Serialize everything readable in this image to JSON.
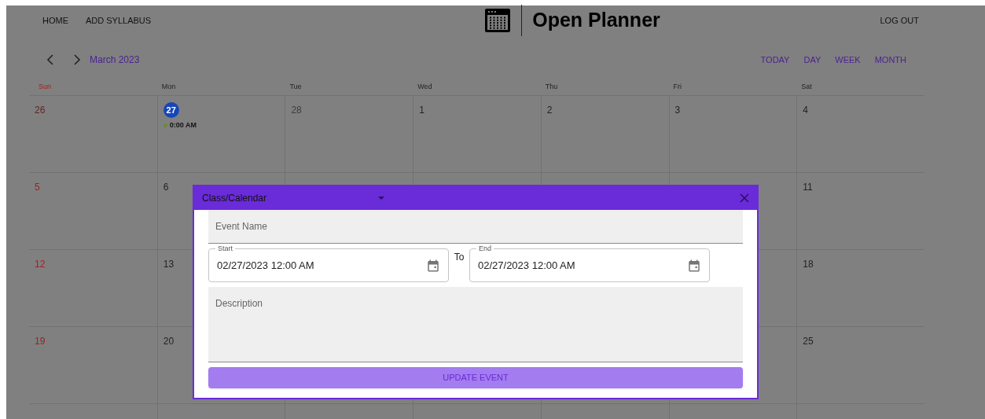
{
  "nav": [
    {
      "label": "HOME"
    },
    {
      "label": "ADD SYLLABUS"
    }
  ],
  "app_title": "Open Planner",
  "logout": "LOG OUT",
  "calendar": {
    "title": "March 2023",
    "buttons": [
      "TODAY",
      "DAY",
      "WEEK",
      "MONTH"
    ],
    "weekdays": [
      {
        "label": "Sun",
        "kind": "sunday"
      },
      {
        "label": "Mon",
        "kind": "weekday"
      },
      {
        "label": "Tue",
        "kind": "weekday"
      },
      {
        "label": "Wed",
        "kind": "weekday"
      },
      {
        "label": "Thu",
        "kind": "weekday"
      },
      {
        "label": "Fri",
        "kind": "weekday"
      },
      {
        "label": "Sat",
        "kind": "weekday"
      }
    ],
    "weeks": [
      [
        {
          "day": "26",
          "kind": "other-month"
        },
        {
          "day": "27",
          "kind": "today",
          "events": [
            {
              "time": "0:00 AM",
              "color": "#6b8a3a"
            }
          ]
        },
        {
          "day": "28",
          "kind": "other-month"
        },
        {
          "day": "1",
          "kind": "current"
        },
        {
          "day": "2",
          "kind": "current"
        },
        {
          "day": "3",
          "kind": "current"
        },
        {
          "day": "4",
          "kind": "current"
        }
      ],
      [
        {
          "day": "5",
          "kind": "current"
        },
        {
          "day": "6",
          "kind": "current"
        },
        {
          "kind": "hidden"
        },
        {
          "kind": "hidden"
        },
        {
          "kind": "hidden"
        },
        {
          "kind": "hidden"
        },
        {
          "day": "11",
          "kind": "current"
        }
      ],
      [
        {
          "day": "12",
          "kind": "current"
        },
        {
          "day": "13",
          "kind": "current"
        },
        {
          "kind": "hidden"
        },
        {
          "kind": "hidden"
        },
        {
          "kind": "hidden"
        },
        {
          "kind": "hidden"
        },
        {
          "day": "18",
          "kind": "current"
        }
      ],
      [
        {
          "day": "19",
          "kind": "current"
        },
        {
          "day": "20",
          "kind": "current"
        },
        {
          "kind": "hidden"
        },
        {
          "kind": "hidden"
        },
        {
          "kind": "hidden"
        },
        {
          "kind": "hidden"
        },
        {
          "day": "25",
          "kind": "current"
        }
      ]
    ]
  },
  "dialog": {
    "calendar_select": "Class/Calendar",
    "event_name": {
      "placeholder": "Event Name"
    },
    "start": {
      "label": "Start",
      "value": "02/27/2023 12:00 AM"
    },
    "separator": "To",
    "end": {
      "label": "End",
      "value": "02/27/2023 12:00 AM"
    },
    "description": {
      "placeholder": "Description"
    },
    "submit": "UPDATE EVENT"
  }
}
